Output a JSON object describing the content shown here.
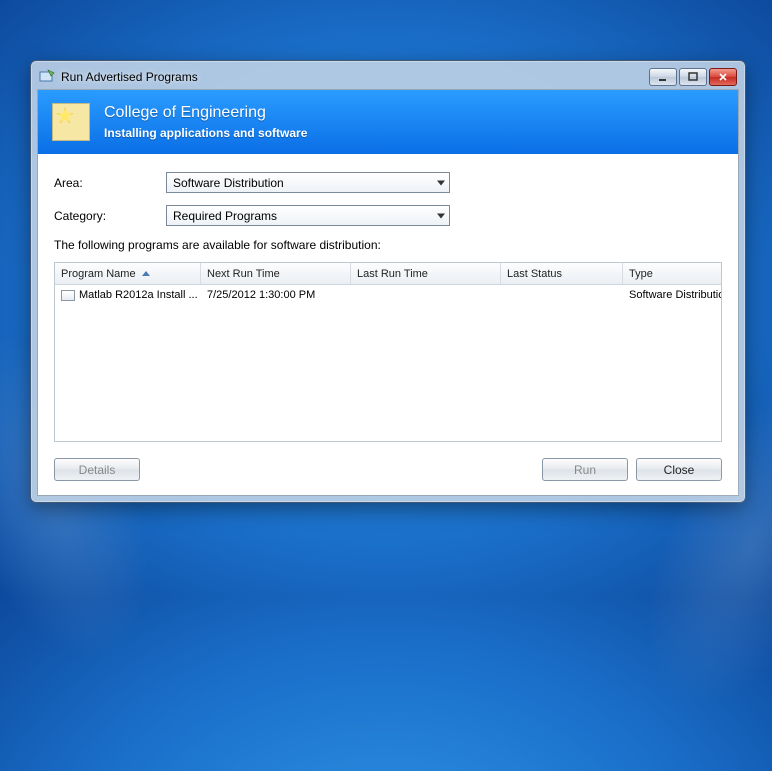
{
  "window": {
    "title": "Run Advertised Programs"
  },
  "banner": {
    "heading": "College of Engineering",
    "sub": "Installing applications and software"
  },
  "form": {
    "area_label": "Area:",
    "area_value": "Software Distribution",
    "category_label": "Category:",
    "category_value": "Required Programs"
  },
  "hint": "The following programs are available for software distribution:",
  "columns": {
    "c0": "Program Name",
    "c1": "Next Run Time",
    "c2": "Last Run Time",
    "c3": "Last Status",
    "c4": "Type"
  },
  "rows": [
    {
      "name": "Matlab R2012a Install ...",
      "next": "7/25/2012 1:30:00 PM",
      "last": "",
      "status": "",
      "type": "Software Distribution"
    }
  ],
  "buttons": {
    "details": "Details",
    "run": "Run",
    "close": "Close"
  }
}
